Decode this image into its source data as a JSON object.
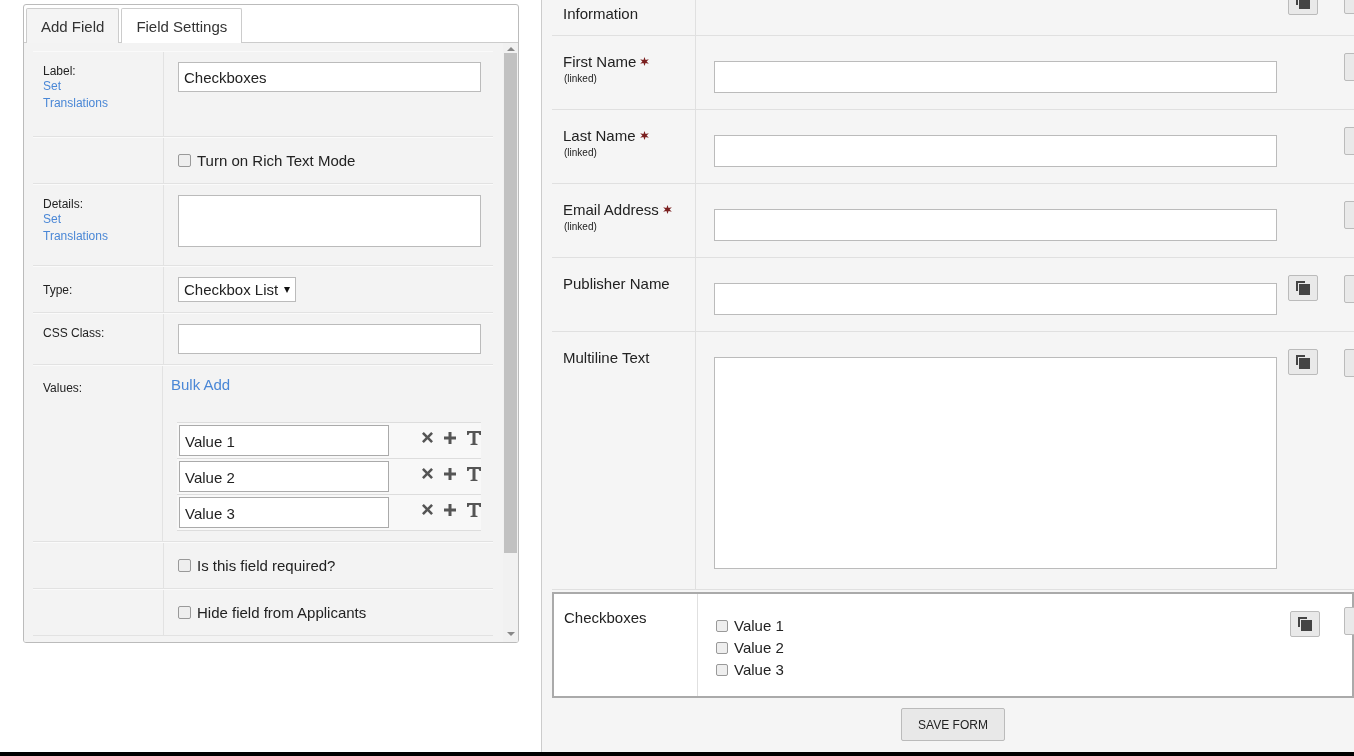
{
  "tabs": [
    {
      "label": "Add Field",
      "selected": false
    },
    {
      "label": "Field Settings",
      "selected": true
    }
  ],
  "settings": [
    {
      "kind": "text",
      "label": "Label:",
      "link": "Set Translations",
      "value": "Checkboxes"
    },
    {
      "kind": "checkbox",
      "text": "Turn on Rich Text Mode",
      "checked": false
    },
    {
      "kind": "textarea",
      "label": "Details:",
      "link": "Set Translations"
    },
    {
      "kind": "select",
      "label": "Type:",
      "value": "Checkbox List"
    },
    {
      "kind": "text",
      "label": "CSS Class:"
    },
    {
      "kind": "values",
      "label": "Values:",
      "link": "Bulk Add",
      "values": [
        "Value 1",
        "Value 2",
        "Value 3"
      ]
    },
    {
      "kind": "checkbox",
      "text": "Is this field required?",
      "checked": false
    },
    {
      "kind": "checkbox",
      "text": "Hide field from Applicants",
      "checked": false
    }
  ],
  "form_fields": [
    {
      "kind": "heading",
      "label": "Information",
      "required": false,
      "copy": true,
      "selected": false
    },
    {
      "kind": "text",
      "label": "First Name",
      "required": true,
      "note": "(linked)",
      "copy": false,
      "selected": false
    },
    {
      "kind": "text",
      "label": "Last Name",
      "required": true,
      "note": "(linked)",
      "copy": false,
      "selected": false
    },
    {
      "kind": "text",
      "label": "Email Address",
      "required": true,
      "note": "(linked)",
      "copy": false,
      "selected": false
    },
    {
      "kind": "text",
      "label": "Publisher Name",
      "required": false,
      "copy": true,
      "selected": false
    },
    {
      "kind": "textarea",
      "label": "Multiline Text",
      "required": false,
      "copy": true,
      "selected": false
    },
    {
      "kind": "checkboxes",
      "label": "Checkboxes",
      "required": false,
      "copy": true,
      "selected": true,
      "options": [
        {
          "label": "Value 1",
          "checked": false
        },
        {
          "label": "Value 2",
          "checked": false
        },
        {
          "label": "Value 3",
          "checked": false
        }
      ]
    }
  ],
  "save_button": "SAVE FORM"
}
